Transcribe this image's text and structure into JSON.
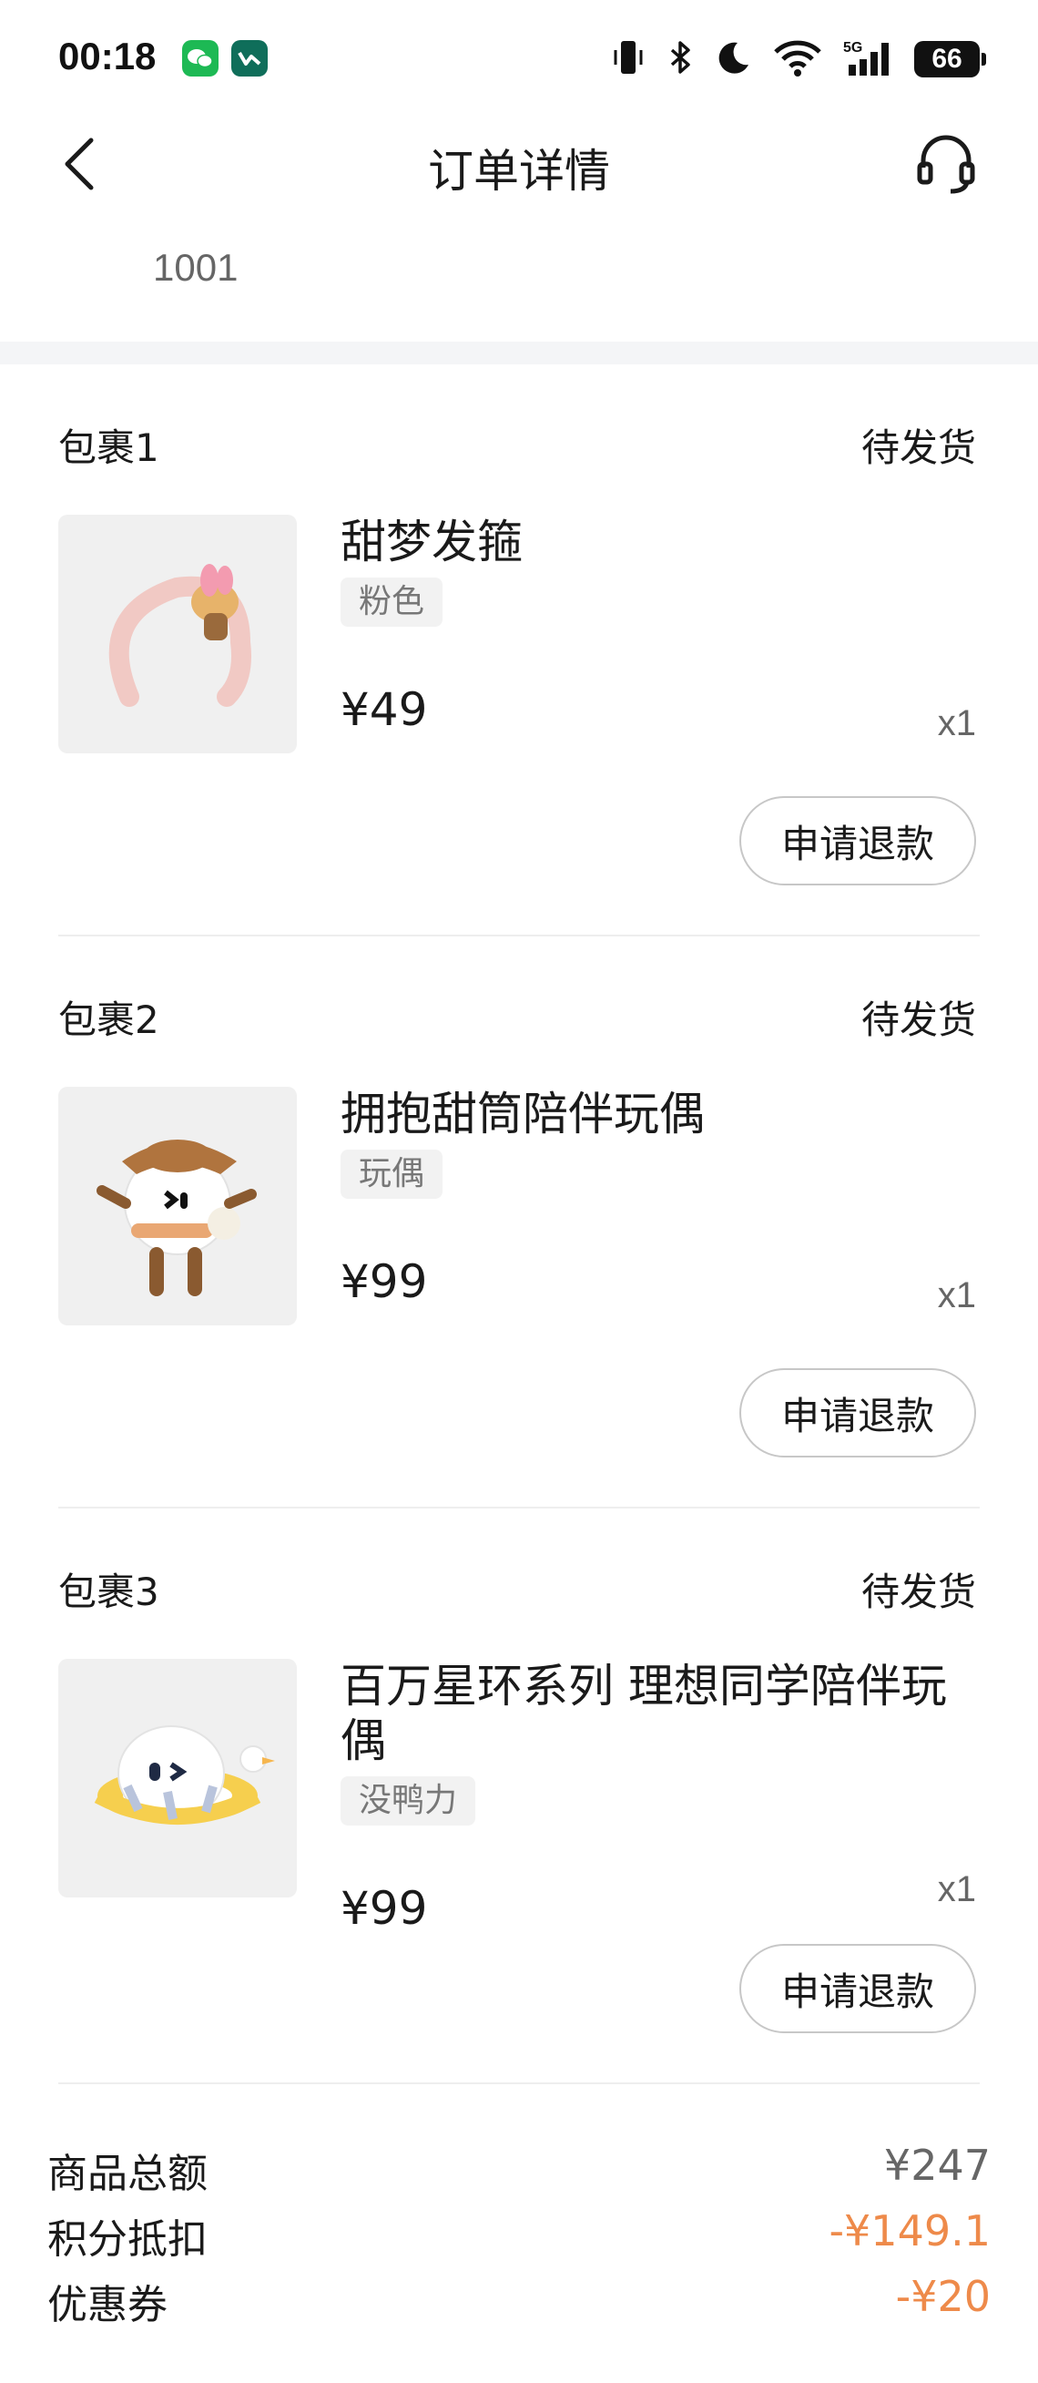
{
  "status_bar": {
    "time": "00:18",
    "battery": "66",
    "network": "5G"
  },
  "nav": {
    "title": "订单详情"
  },
  "order": {
    "number": "1001"
  },
  "packages": [
    {
      "title": "包裹1",
      "status": "待发货",
      "product_name": "甜梦发箍",
      "tag": "粉色",
      "price": "¥49",
      "qty": "x1",
      "refund_label": "申请退款"
    },
    {
      "title": "包裹2",
      "status": "待发货",
      "product_name": "拥抱甜筒陪伴玩偶",
      "tag": "玩偶",
      "price": "¥99",
      "qty": "x1",
      "refund_label": "申请退款"
    },
    {
      "title": "包裹3",
      "status": "待发货",
      "product_name": "百万星环系列 理想同学陪伴玩偶",
      "tag": "没鸭力",
      "price": "¥99",
      "qty": "x1",
      "refund_label": "申请退款"
    }
  ],
  "summary": {
    "goods_total_label": "商品总额",
    "goods_total_value": "¥247",
    "points_label": "积分抵扣",
    "points_value": "-¥149.1",
    "coupon_label": "优惠券",
    "coupon_value": "-¥20"
  },
  "colors": {
    "discount": "#ee8a4a",
    "muted_value": "#666666",
    "text": "#1a1a1a"
  }
}
